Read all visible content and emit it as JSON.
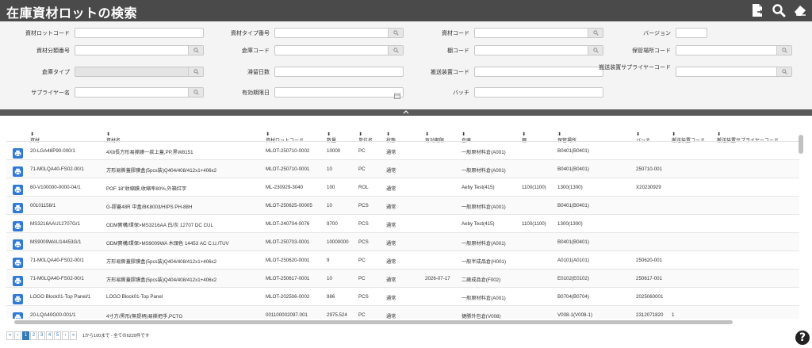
{
  "title": "在庫資材ロットの検索",
  "form": {
    "lot_code": {
      "label": "資材ロットコード",
      "value": ""
    },
    "material_type_no": {
      "label": "資材タイプ番号",
      "value": ""
    },
    "material_code": {
      "label": "資材コード",
      "value": ""
    },
    "version": {
      "label": "バージョン",
      "value": ""
    },
    "material_class_no": {
      "label": "資材分類番号",
      "value": ""
    },
    "warehouse_code": {
      "label": "倉庫コード",
      "value": ""
    },
    "shelf_code": {
      "label": "棚コード",
      "value": ""
    },
    "storage_location_code": {
      "label": "保管場所コード",
      "value": ""
    },
    "warehouse_type": {
      "label": "倉庫タイプ",
      "value": ""
    },
    "stagnant_days": {
      "label": "滞留日数",
      "value": ""
    },
    "transport_device_code": {
      "label": "搬送装置コード",
      "value": ""
    },
    "transport_supplier_code": {
      "label": "搬送装置サプライヤーコード",
      "value": ""
    },
    "supplier_name": {
      "label": "サプライヤー名",
      "value": ""
    },
    "expiry_date": {
      "label": "有効期限日",
      "value": ""
    },
    "batch": {
      "label": "バッチ",
      "value": ""
    }
  },
  "columns": [
    "資材",
    "資材名",
    "資材ロットコード",
    "数量",
    "単位名",
    "状態",
    "有効期限",
    "倉庫",
    "棚",
    "保管場所",
    "バッチ",
    "搬送装置コード",
    "搬送装置サプライヤーコード"
  ],
  "rows": [
    [
      "20-LGA48P90-000/1",
      "4X8長方形易撕膜一款上蓋,PP,黑W8151",
      "MLOT-250710-0002",
      "10000",
      "PC",
      "通常",
      "",
      "一般原材料倉(A001)",
      "",
      "B0401(B0401)",
      "",
      "",
      ""
    ],
    [
      "71-M0LQA40-FS02-00/1",
      "方形易撕蓋膠膜盒(5pcs装)Q404/408/412x1+406x2",
      "MLOT-250710-0001",
      "10",
      "PC",
      "通常",
      "",
      "一般原材料倉(A001)",
      "",
      "B0401(B0401)",
      "250710-001",
      "",
      ""
    ],
    [
      "80-V100000-0000-04/1",
      "POF 18\"收縮膜,收縮率80%,外箱红字",
      "ML-230929-3040",
      "100",
      "ROL",
      "通常",
      "",
      "Aeby Test(415)",
      "1100(1100)",
      "1300(1300)",
      "X20230929",
      "",
      ""
    ],
    [
      "00101158/1",
      "G-膠蓋48R 中盒/BK8003/HIPS PH-88H",
      "MLOT-250625-00005",
      "10",
      "PCS",
      "通常",
      "",
      "一般原材料倉(A001)",
      "",
      "B0401(B0401)",
      "",
      "",
      ""
    ],
    [
      "MS3216AAU12707G/1",
      "ODM實構/環保>MS3216AA 白/灰 12707 DC CUL",
      "MLOT-240704-0076",
      "9700",
      "PCS",
      "通常",
      "",
      "Aeby Test(415)",
      "1100(1100)",
      "1300(1300)",
      "",
      "",
      ""
    ],
    [
      "MS9009WAU14453G/1",
      "ODM實構/環保>MS9009WA 木頭色 14453 AC C.U./TUV",
      "MLOT-250703-0001",
      "10000000",
      "PCS",
      "通常",
      "",
      "一般原材料倉(A001)",
      "",
      "B0401(B0401)",
      "",
      "",
      ""
    ],
    [
      "71-M0LQA40-FS02-00/1",
      "方形易撕蓋膠膜盒(5pcs装)Q404/408/412x1+406x2",
      "MLOT-250620-0001",
      "9",
      "PC",
      "通常",
      "",
      "一般半成品倉(H001)",
      "",
      "A0101(A0101)",
      "250620-001",
      "",
      ""
    ],
    [
      "71-M0LQA40-FS02-00/1",
      "方形易撕蓋膠膜盒(5pcs装)Q404/408/412x1+406x2",
      "MLOT-250617-0001",
      "10",
      "PC",
      "通常",
      "2026-07-17",
      "二廠成品倉(F002)",
      "",
      "E0102(E0102)",
      "250617-001",
      "",
      ""
    ],
    [
      "LOGO Block01-Top Panel/1",
      "LOGO Block01-Top Panel",
      "MLOT-202506-0002",
      "986",
      "PCS",
      "通常",
      "",
      "一般原材料倉(A001)",
      "",
      "B0704(B0704)",
      "2025060001",
      "",
      ""
    ],
    [
      "20-LQA40G00-001/1",
      "4寸方/黑形(無提柄)易撕把手,PCTG",
      "001100002097.001",
      "2975.524",
      "PC",
      "通常",
      "",
      "捷勝外包倉(V008)",
      "",
      "V008-1(V008-1)",
      "2312071820",
      "1",
      ""
    ]
  ],
  "pager": {
    "first": "«",
    "prev": "‹",
    "pages": [
      "1",
      "2",
      "3",
      "4",
      "5"
    ],
    "next": "›",
    "last": "»",
    "info": "1から100まで - 全ての6229件です"
  },
  "help_label": "?"
}
